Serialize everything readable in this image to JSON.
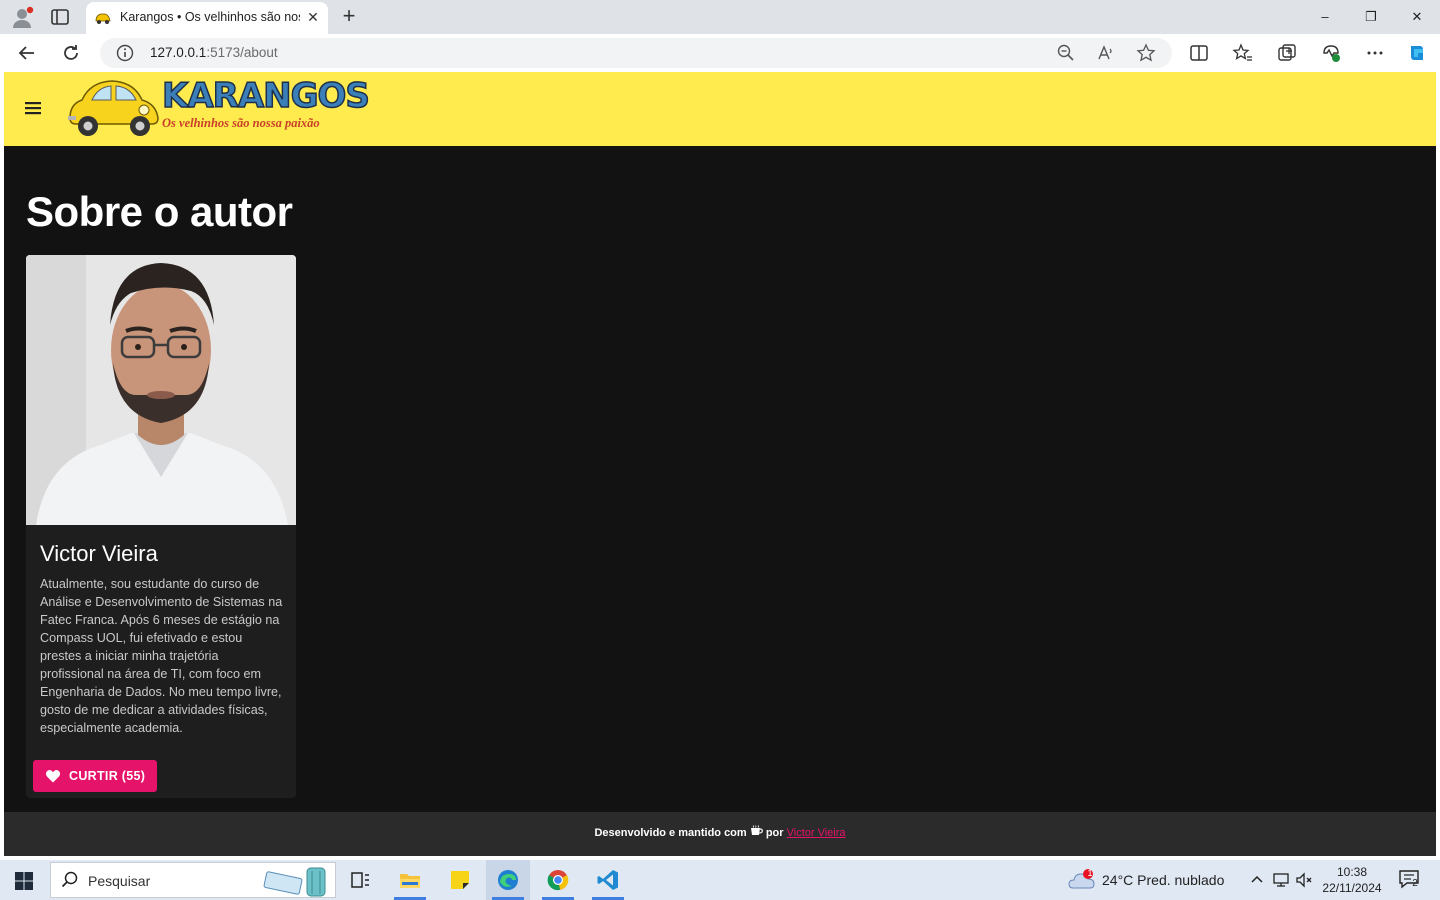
{
  "browser": {
    "tab_title": "Karangos • Os velhinhos são nossa paixão",
    "new_tab_label": "+",
    "close_tab_label": "✕",
    "minimize_label": "–",
    "restore_label": "❐",
    "close_window_label": "✕",
    "url_host": "127.0.0.1",
    "url_path": ":5173/about"
  },
  "header": {
    "logo_title": "KARANGOS",
    "logo_tagline": "Os velhinhos são nossa paixão",
    "header_color": "#ffeb4d"
  },
  "page": {
    "title": "Sobre o autor"
  },
  "author_card": {
    "name": "Victor Vieira",
    "bio": "Atualmente, sou estudante do curso de Análise e Desenvolvimento de Sistemas na Fatec Franca. Após 6 meses de estágio na Compass UOL, fui efetivado e estou prestes a iniciar minha trajetória profissional na área de TI, com foco em Engenharia de Dados. No meu tempo livre, gosto de me dedicar a atividades físicas, especialmente academia.",
    "like_label": "CURTIR (55)",
    "like_color": "#e5136a"
  },
  "footer": {
    "text_before": "Desenvolvido e mantido com",
    "text_after": "por",
    "author_link": "Victor Vieira"
  },
  "taskbar": {
    "search_placeholder": "Pesquisar",
    "weather_badge": "1",
    "weather": "24°C  Pred. nublado",
    "time": "10:38",
    "date": "22/11/2024",
    "notification_count": "2"
  },
  "icons": [
    "profile-icon",
    "tab-actions-icon",
    "car-favicon-icon",
    "back-icon",
    "refresh-icon",
    "info-icon",
    "zoom-out-icon",
    "read-aloud-icon",
    "favorite-star-icon",
    "split-screen-icon",
    "favorites-icon",
    "collections-icon",
    "browser-essentials-icon",
    "more-icon",
    "copilot-icon",
    "menu-icon",
    "heart-icon",
    "coffee-icon",
    "windows-start-icon",
    "search-icon",
    "task-view-icon",
    "file-explorer-icon",
    "sticky-notes-icon",
    "edge-icon",
    "chrome-icon",
    "vscode-icon",
    "cloud-icon",
    "chevron-up-icon",
    "network-icon",
    "volume-muted-icon",
    "notification-icon"
  ]
}
